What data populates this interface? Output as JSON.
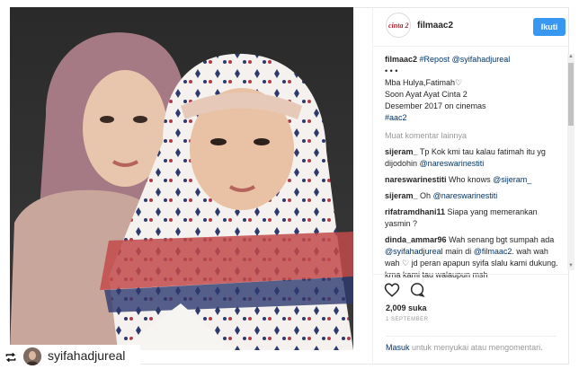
{
  "header": {
    "logo_text": "cinta 2",
    "username": "filmaac2",
    "follow_label": "Ikuti"
  },
  "caption": {
    "author": "filmaac2",
    "repost": "#Repost",
    "mention": "@syifahadjureal",
    "dots": "• • •",
    "lines": [
      "Mba Hulya,Fatimah♡",
      "Soon Ayat Ayat Cinta 2",
      "Desember 2017 on cinemas"
    ],
    "hashtag": "#aac2"
  },
  "more_comments": "Muat komentar lainnya",
  "comments": [
    {
      "user": "sijeram_",
      "text": "Tp Kok kmi tau kalau fatimah itu yg dijodohin",
      "mention": "@nareswarinestiti"
    },
    {
      "user": "nareswarinestiti",
      "text": "Who knows",
      "mention": "@sijeram_"
    },
    {
      "user": "sijeram_",
      "text": "Oh",
      "mention": "@nareswarinestiti"
    },
    {
      "user": "rifatramdhani11",
      "text": "Siapa yang memerankan yasmin ?",
      "mention": ""
    },
    {
      "user": "dinda_ammar96",
      "text": "Wah senang bgt sumpah ada",
      "mention": "@syifahadjureal",
      "text2": "main di",
      "mention2": "@filmaac2",
      "text3": ". wah wah wah ♡ jd peran apapun syifa slalu kami dukung. krna kami tau walaupun msh"
    }
  ],
  "icons": {
    "like": "heart-icon",
    "comment": "comment-icon",
    "repost": "repost-icon"
  },
  "likes": "2,009 suka",
  "date": "1 SEPTEMBER",
  "login": {
    "link": "Masuk",
    "text": "untuk menyukai atau mengomentari."
  },
  "repost_bar": {
    "username": "syifahadjureal"
  },
  "colors": {
    "accent": "#3897f0",
    "link": "#003569"
  }
}
